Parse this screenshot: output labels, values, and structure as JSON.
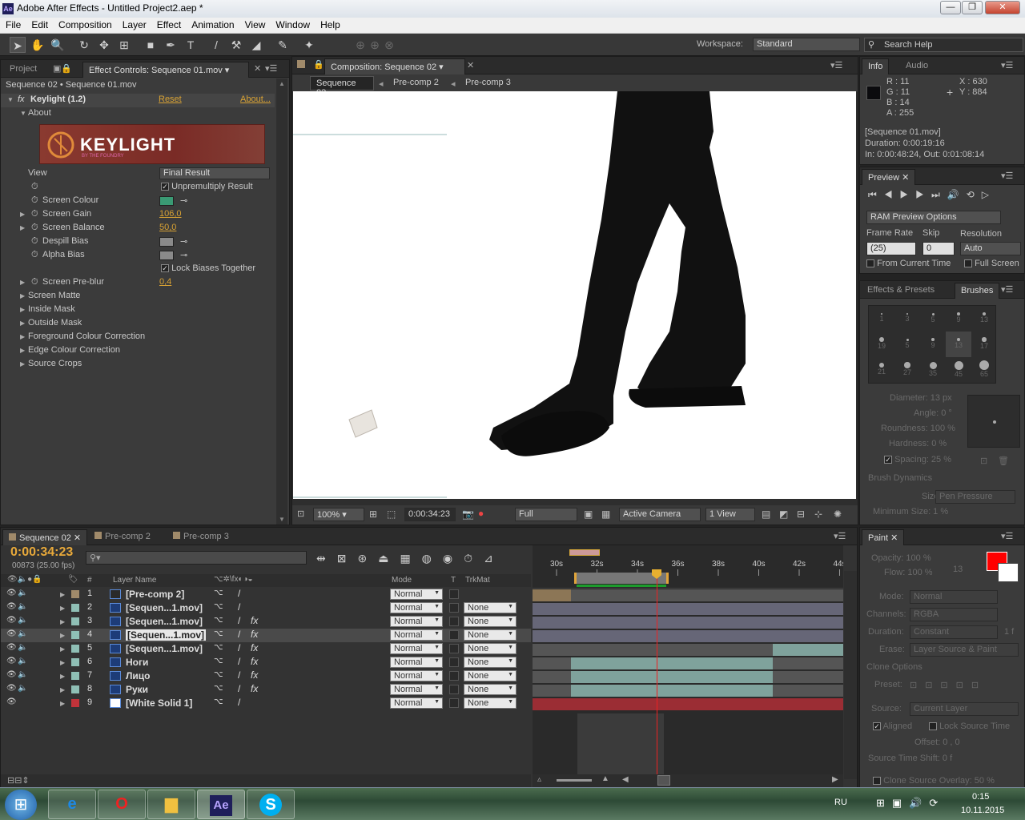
{
  "window": {
    "title": "Adobe After Effects - Untitled Project2.aep *",
    "logo": "Ae",
    "buttons": [
      "—",
      "❐",
      "✕"
    ]
  },
  "menu": [
    "File",
    "Edit",
    "Composition",
    "Layer",
    "Effect",
    "Animation",
    "View",
    "Window",
    "Help"
  ],
  "toolbar": {
    "workspace_label": "Workspace:",
    "workspace_value": "Standard",
    "search_placeholder": "Search Help"
  },
  "effect_panel": {
    "tabs": [
      "Project",
      "Effect Controls: Sequence 01.mov"
    ],
    "breadcrumb": "Sequence 02 • Sequence 01.mov",
    "effect_name": "Keylight (1.2)",
    "reset": "Reset",
    "about_link": "About...",
    "about_group": "About",
    "logo_text": "KEYLIGHT",
    "logo_sub": "BY THE FOUNDRY",
    "view_label": "View",
    "view_value": "Final Result",
    "unpremultiply": "Unpremultiply Result",
    "screen_colour": "Screen Colour",
    "screen_colour_value": "#3a9a74",
    "screen_gain": "Screen Gain",
    "screen_gain_value": "106,0",
    "screen_balance": "Screen Balance",
    "screen_balance_value": "50,0",
    "despill_bias": "Despill Bias",
    "alpha_bias": "Alpha Bias",
    "lock_biases": "Lock Biases Together",
    "screen_preblur": "Screen Pre-blur",
    "screen_preblur_value": "0,4",
    "groups": [
      "Screen Matte",
      "Inside Mask",
      "Outside Mask",
      "Foreground Colour Correction",
      "Edge Colour Correction",
      "Source Crops"
    ]
  },
  "comp_panel": {
    "tab": "Composition: Sequence 02",
    "flow": [
      "Sequence 02",
      "Pre-comp 2",
      "Pre-comp 3"
    ],
    "zoom": "100%",
    "timecode": "0:00:34:23",
    "resolution": "Full",
    "camera": "Active Camera",
    "views": "1 View"
  },
  "info_panel": {
    "tabs": [
      "Info",
      "Audio"
    ],
    "r": "R : 11",
    "g": "G : 11",
    "b": "B : 14",
    "a": "A : 255",
    "x": "X : 630",
    "y": "Y : 884",
    "line1": "[Sequence 01.mov]",
    "line2": "Duration: 0:00:19:16",
    "line3": "In: 0:00:48:24, Out: 0:01:08:14"
  },
  "preview_panel": {
    "tab": "Preview",
    "ram_options": "RAM Preview Options",
    "frame_rate_label": "Frame Rate",
    "frame_rate": "(25)",
    "skip_label": "Skip",
    "skip": "0",
    "resolution_label": "Resolution",
    "resolution": "Auto",
    "from_current": "From Current Time",
    "full_screen": "Full Screen"
  },
  "brushes_panel": {
    "tabs": [
      "Effects & Presets",
      "Brushes"
    ],
    "sizes": [
      "1",
      "3",
      "5",
      "9",
      "13",
      "19",
      "5",
      "9",
      "13",
      "17",
      "21",
      "27",
      "35",
      "45",
      "65"
    ],
    "diameter": "Diameter: 13 px",
    "angle": "Angle: 0 °",
    "roundness": "Roundness: 100 %",
    "hardness": "Hardness: 0 %",
    "spacing": "Spacing: 25 %",
    "dynamics": "Brush Dynamics",
    "size_label": "Size:",
    "size_value": "Pen Pressure",
    "min_size": "Minimum Size: 1 %"
  },
  "paint_panel": {
    "tab": "Paint",
    "opacity": "Opacity: 100 %",
    "flow": "Flow: 100 %",
    "brush_size": "13",
    "mode_label": "Mode:",
    "mode_value": "Normal",
    "channels_label": "Channels:",
    "channels_value": "RGBA",
    "duration_label": "Duration:",
    "duration_value": "Constant",
    "duration_f": "1 f",
    "erase_label": "Erase:",
    "erase_value": "Layer Source & Paint",
    "clone_options": "Clone Options",
    "preset_label": "Preset:",
    "source_label": "Source:",
    "source_value": "Current Layer",
    "aligned": "Aligned",
    "lock_source": "Lock Source Time",
    "offset": "Offset: 0 , 0",
    "shift": "Source Time Shift: 0 f",
    "overlay": "Clone Source Overlay: 50 %",
    "fg_color": "#ff0000",
    "bg_color": "#ffffff"
  },
  "timeline": {
    "tabs": [
      "Sequence 02",
      "Pre-comp 2",
      "Pre-comp 3"
    ],
    "timecode": "0:00:34:23",
    "frame_info": "00873 (25.00 fps)",
    "col_hash": "#",
    "col_name": "Layer Name",
    "col_mode": "Mode",
    "col_t": "T",
    "col_trkmat": "TrkMat",
    "ruler": [
      "30s",
      "32s",
      "34s",
      "36s",
      "38s",
      "40s",
      "42s",
      "44s"
    ],
    "layers": [
      {
        "num": "1",
        "name": "[Pre-comp 2]",
        "mode": "Normal",
        "trkmat": "",
        "color": "#a08a6a"
      },
      {
        "num": "2",
        "name": "[Sequen...1.mov]",
        "mode": "Normal",
        "trkmat": "None",
        "color": "#8fbfb5"
      },
      {
        "num": "3",
        "name": "[Sequen...1.mov]",
        "mode": "Normal",
        "trkmat": "None",
        "color": "#8fbfb5"
      },
      {
        "num": "4",
        "name": "[Sequen...1.mov]",
        "mode": "Normal",
        "trkmat": "None",
        "color": "#8fbfb5"
      },
      {
        "num": "5",
        "name": "[Sequen...1.mov]",
        "mode": "Normal",
        "trkmat": "None",
        "color": "#8fbfb5"
      },
      {
        "num": "6",
        "name": "Ноги",
        "mode": "Normal",
        "trkmat": "None",
        "color": "#8fbfb5"
      },
      {
        "num": "7",
        "name": "Лицо",
        "mode": "Normal",
        "trkmat": "None",
        "color": "#8fbfb5"
      },
      {
        "num": "8",
        "name": "Руки",
        "mode": "Normal",
        "trkmat": "None",
        "color": "#8fbfb5"
      },
      {
        "num": "9",
        "name": "[White Solid 1]",
        "mode": "Normal",
        "trkmat": "None",
        "color": "#c0333a"
      }
    ]
  },
  "taskbar": {
    "lang": "RU",
    "time": "0:15",
    "date": "10.11.2015"
  }
}
